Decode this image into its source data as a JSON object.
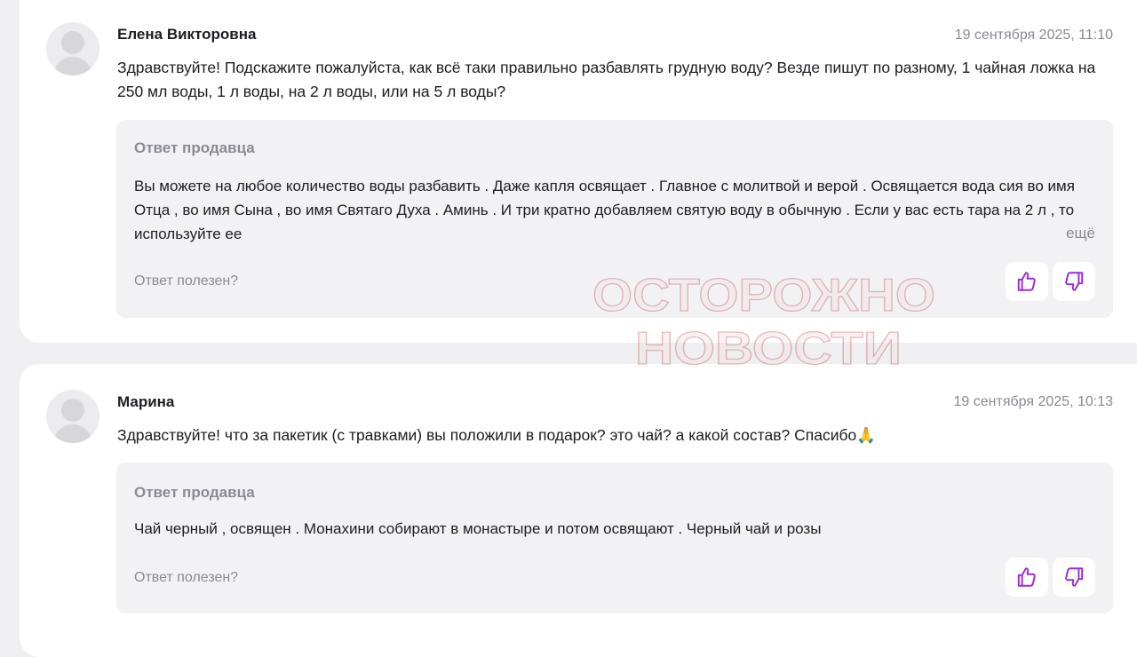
{
  "accent_color": "#9b2bd8",
  "reviews": [
    {
      "author": "Елена Викторовна",
      "date": "19 сентября 2025, 11:10",
      "question": "Здравствуйте! Подскажите пожалуйста, как всё таки правильно разбавлять грудную воду? Везде пишут по разному, 1 чайная ложка на 250 мл воды, 1 л воды, на 2 л воды, или на 5 л воды?",
      "answer_title": "Ответ продавца",
      "answer_text": "Вы можете на любое количество воды разбавить . Даже капля освящает . Главное с молитвой и верой . Освящается вода сия во имя Отца , во имя Сына , во имя Святаго Духа . Аминь . И три кратно добавляем святую воду в обычную . Если у вас есть тара на 2 л , то используйте ее",
      "more_label": "ещё",
      "helpful_label": "Ответ полезен?",
      "like_icon": "thumbs-up-icon",
      "dislike_icon": "thumbs-down-icon"
    },
    {
      "author": "Марина",
      "date": "19 сентября 2025, 10:13",
      "question": "Здравствуйте! что за пакетик (с травками) вы положили в подарок? это чай? а какой состав? Спасибо🙏",
      "answer_title": "Ответ продавца",
      "answer_text": "Чай черный , освящен . Монахини собирают в монастыре и потом освящают . Черный чай и розы",
      "helpful_label": "Ответ полезен?",
      "like_icon": "thumbs-up-icon",
      "dislike_icon": "thumbs-down-icon"
    }
  ],
  "watermark": {
    "line1": "ОСТОРОЖНО",
    "line2": "НОВОСТИ"
  }
}
